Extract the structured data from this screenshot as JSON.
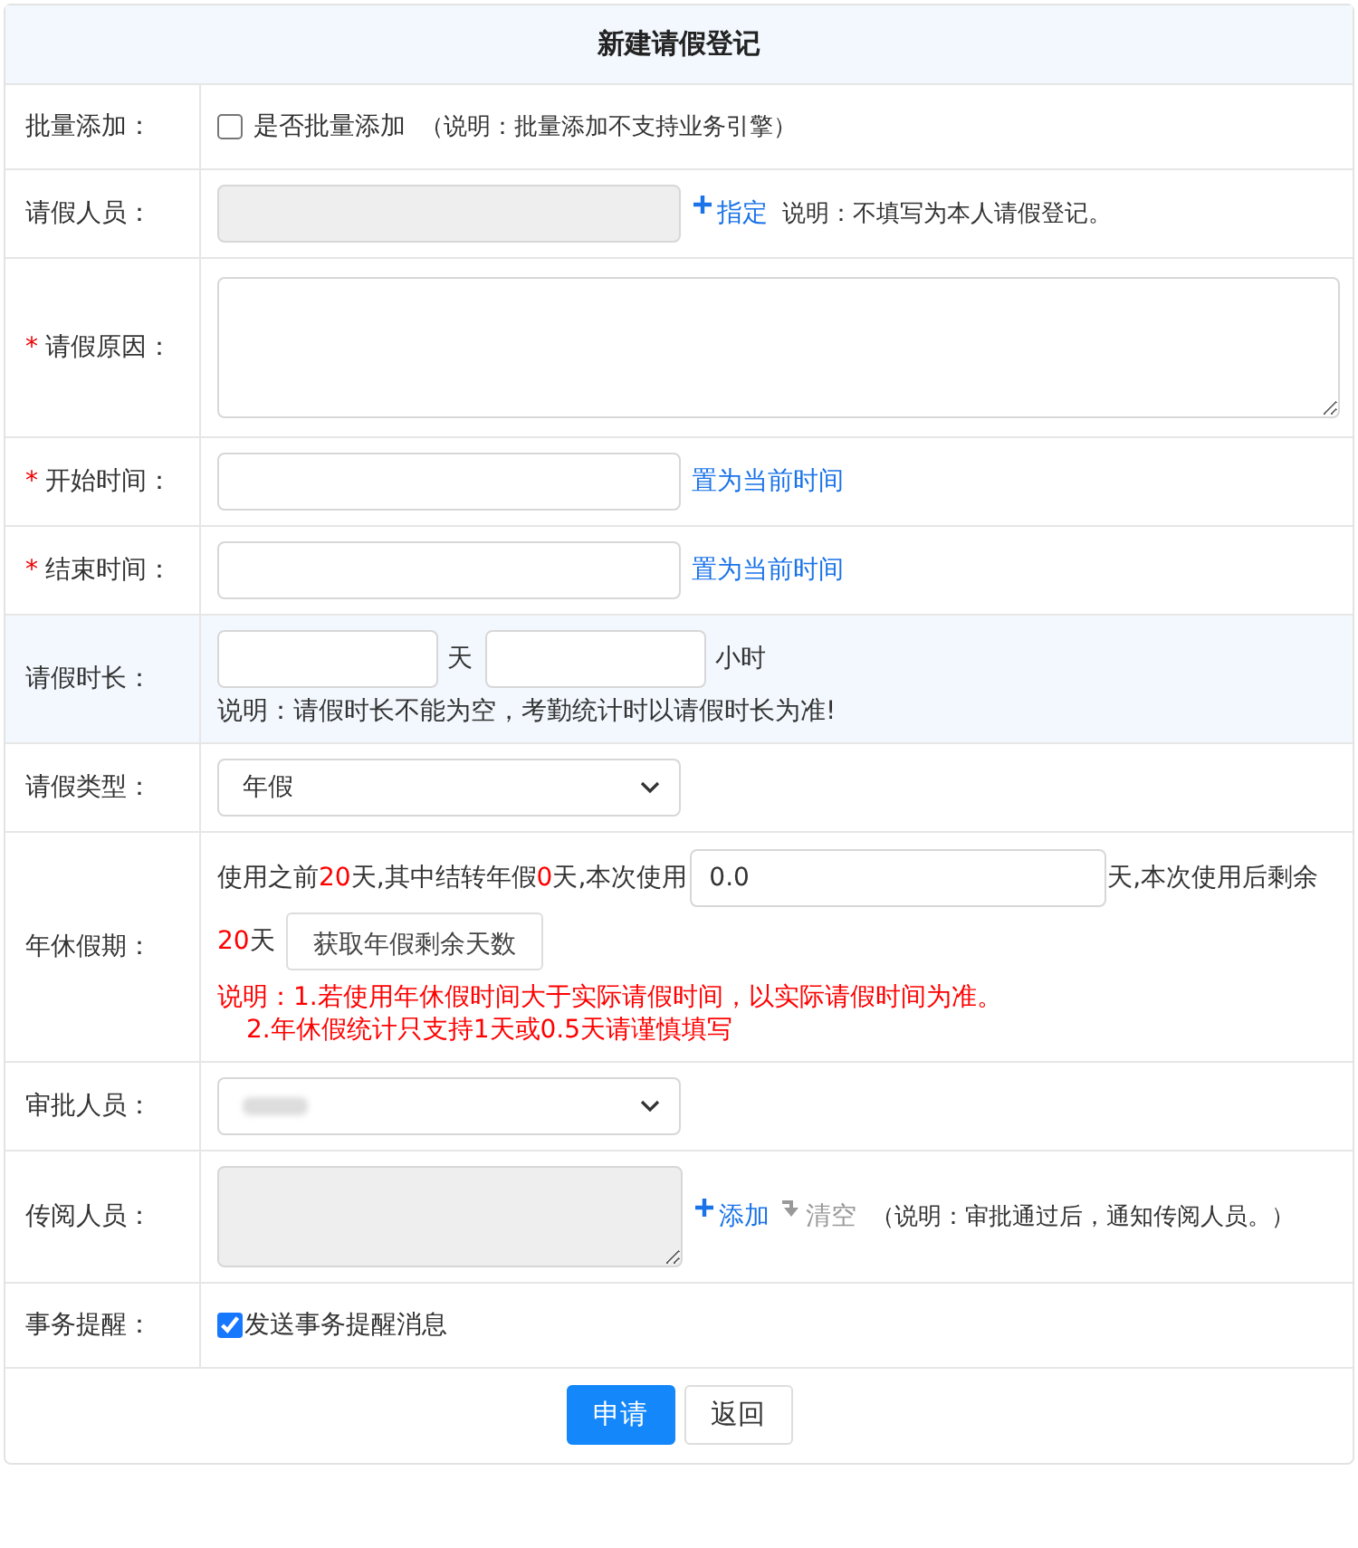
{
  "title": "新建请假登记",
  "rows": [
    {
      "kind": "checkbox",
      "label": "批量添加：",
      "checkbox": {
        "label": "是否批量添加",
        "checked": false
      },
      "note": "（说明：批量添加不支持业务引擎）"
    },
    {
      "kind": "picker",
      "label": "请假人员：",
      "link": "指定",
      "note": "说明：不填写为本人请假登记。"
    },
    {
      "kind": "textarea",
      "label": "请假原因：",
      "required_mark": "*"
    },
    {
      "kind": "datetime",
      "label": "开始时间：",
      "required_mark": "*",
      "link": "置为当前时间"
    },
    {
      "kind": "datetime",
      "label": "结束时间：",
      "required_mark": "*",
      "link": "置为当前时间"
    },
    {
      "kind": "duration",
      "label": "请假时长：",
      "highlighted": true,
      "units": [
        "天",
        "小时"
      ],
      "note": "说明：请假时长不能为空，考勤统计时以请假时长为准!"
    },
    {
      "kind": "select",
      "label": "请假类型：",
      "value": "年假"
    },
    {
      "kind": "annual",
      "label": "年休假期：",
      "before": [
        {
          "text": "使用之前",
          "red": false
        },
        {
          "text": "20",
          "red": true
        },
        {
          "text": "天,其中结转年假",
          "red": false
        },
        {
          "text": "0",
          "red": true
        },
        {
          "text": "天,本次使用",
          "red": false
        }
      ],
      "value": "0.0",
      "after": [
        {
          "text": "天,本次使用",
          "red": false
        },
        {
          "text": "后剩余",
          "red": false
        },
        {
          "text": "20",
          "red": true
        },
        {
          "text": "天",
          "red": false
        }
      ],
      "button": "获取年假剩余天数",
      "notes": [
        "说明：1.若使用年休假时间大于实际请假时间，以实际请假时间为准。",
        "2.年休假统计只支持1天或0.5天请谨慎填写"
      ]
    },
    {
      "kind": "select",
      "label": "审批人员：",
      "blurred": true
    },
    {
      "kind": "cc",
      "label": "传阅人员：",
      "links": [
        {
          "text": "添加",
          "disabled": false
        },
        {
          "text": "清空",
          "disabled": true
        }
      ],
      "note": "（说明：审批通过后，通知传阅人员。）"
    },
    {
      "kind": "checkbox",
      "label": "事务提醒：",
      "checkbox": {
        "label": "发送事务提醒消息",
        "checked": true
      }
    }
  ],
  "buttons": [
    {
      "label": "申请",
      "primary": true
    },
    {
      "label": "返回",
      "primary": false
    }
  ]
}
